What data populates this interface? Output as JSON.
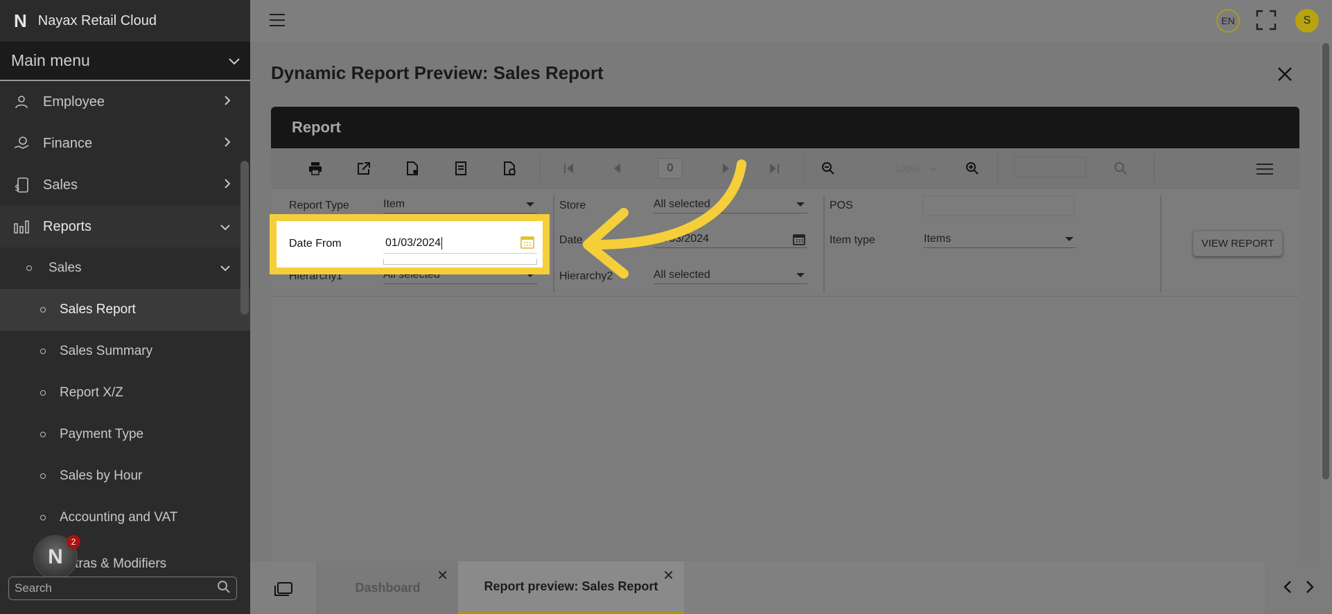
{
  "app": {
    "title": "Nayax Retail Cloud",
    "logo_letter": "N"
  },
  "sidebar": {
    "main_menu_label": "Main menu",
    "items": [
      {
        "label": "Employee",
        "icon": "employee-icon"
      },
      {
        "label": "Finance",
        "icon": "finance-icon"
      },
      {
        "label": "Sales",
        "icon": "sales-icon"
      },
      {
        "label": "Reports",
        "icon": "reports-icon"
      }
    ],
    "reports_sub": {
      "label": "Sales"
    },
    "sales_sub": [
      "Sales Report",
      "Sales Summary",
      "Report X/Z",
      "Payment Type",
      "Sales by Hour",
      "Accounting and VAT",
      "Extras & Modifiers"
    ],
    "search_placeholder": "Search",
    "notification_count": "2"
  },
  "topbar": {
    "language": "EN",
    "user_initial": "S"
  },
  "page": {
    "title": "Dynamic Report Preview: Sales Report"
  },
  "report": {
    "header": "Report",
    "toolbar": {
      "page_number": "0",
      "zoom": "100%"
    },
    "params": {
      "report_type_label": "Report Type",
      "report_type_value": "Item",
      "date_from_label": "Date From",
      "date_from_value": "01/03/2024",
      "hierarchy1_label": "Hierarchy1",
      "hierarchy1_value": "All selected",
      "store_label": "Store",
      "store_value": "All selected",
      "date_to_label": "Date",
      "date_to_value": "31/03/2024",
      "hierarchy2_label": "Hierarchy2",
      "hierarchy2_value": "All selected",
      "pos_label": "POS",
      "item_type_label": "Item type",
      "item_type_value": "Items",
      "view_report_button": "VIEW REPORT"
    }
  },
  "tabs": [
    {
      "label": "Dashboard"
    },
    {
      "label": "Report preview: Sales Report"
    }
  ],
  "colors": {
    "highlight": "#f5cf3a",
    "accent": "#b8a40e",
    "sidebar": "#2b2b2b"
  }
}
